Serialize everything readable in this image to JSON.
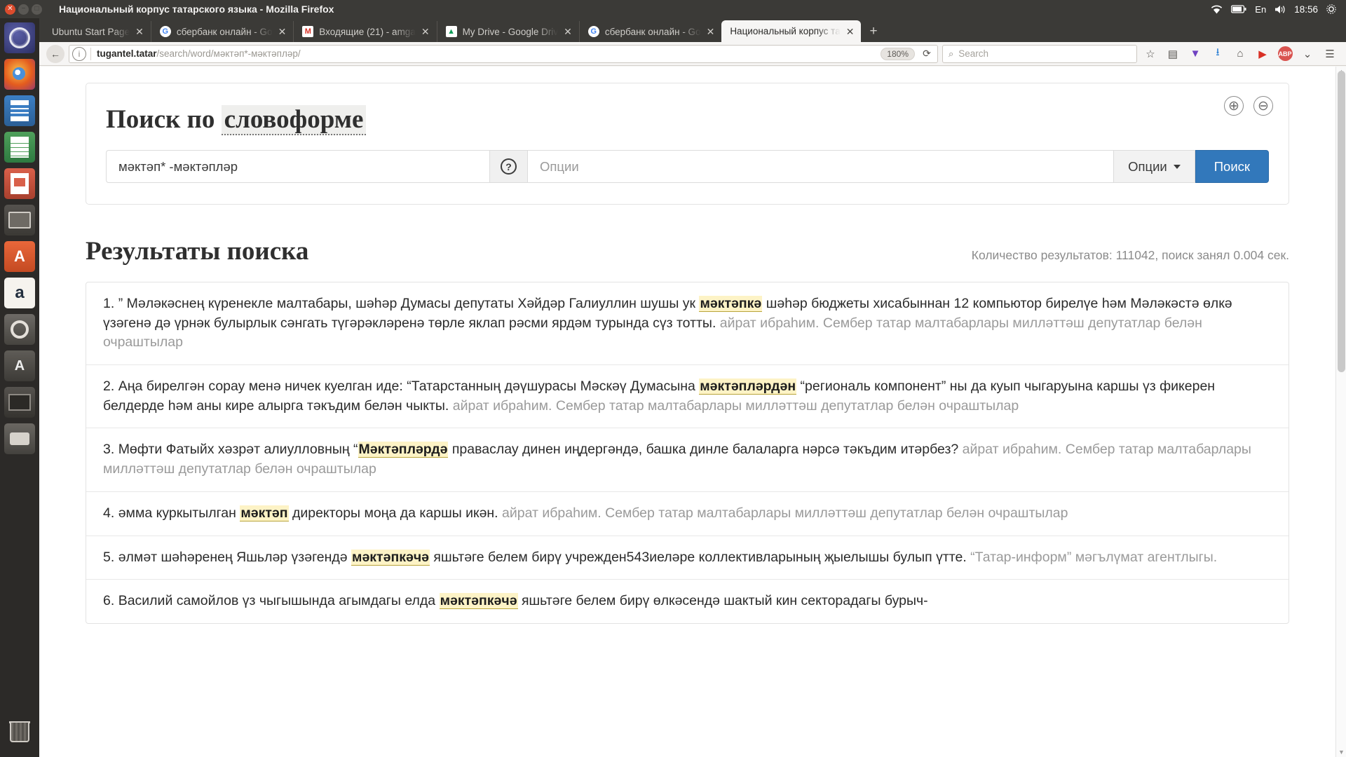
{
  "window": {
    "title": "Национальный корпус татарского языка - Mozilla Firefox",
    "close_glyph": "✕",
    "min_glyph": "−",
    "max_glyph": "□"
  },
  "tray": {
    "wifi_icon": "wifi-icon",
    "battery_icon": "battery-icon",
    "keyboard_layout": "En",
    "volume_icon": "volume-icon",
    "clock": "18:56",
    "gear_icon": "gear-icon"
  },
  "launcher": {
    "items": [
      {
        "name": "dash-home",
        "icon": "ubuntu-dash-icon"
      },
      {
        "name": "firefox",
        "icon": "firefox-icon"
      },
      {
        "name": "libreoffice-writer",
        "icon": "writer-icon"
      },
      {
        "name": "libreoffice-calc",
        "icon": "calc-icon"
      },
      {
        "name": "libreoffice-impress",
        "icon": "impress-icon"
      },
      {
        "name": "files",
        "icon": "files-icon"
      },
      {
        "name": "ubuntu-software",
        "icon": "software-icon"
      },
      {
        "name": "amazon",
        "icon": "amazon-icon"
      },
      {
        "name": "system-settings",
        "icon": "settings-icon"
      },
      {
        "name": "amazon-app",
        "icon": "amazon-app-icon"
      },
      {
        "name": "terminal",
        "icon": "terminal-icon"
      },
      {
        "name": "disk-usage",
        "icon": "disk-icon"
      },
      {
        "name": "trash",
        "icon": "trash-icon"
      }
    ]
  },
  "tabs": [
    {
      "label": "Ubuntu Start Page",
      "favicon": "none",
      "active": false
    },
    {
      "label": "сбербанк онлайн - Go",
      "favicon": "google",
      "active": false
    },
    {
      "label": "Входящие (21) - amga",
      "favicon": "gmail",
      "active": false
    },
    {
      "label": "My Drive - Google Driv",
      "favicon": "drive",
      "active": false
    },
    {
      "label": "сбербанк онлайн - Go",
      "favicon": "google",
      "active": false
    },
    {
      "label": "Национальный корпус та",
      "favicon": "none",
      "active": true
    }
  ],
  "tab_close_glyph": "✕",
  "new_tab_glyph": "+",
  "navbar": {
    "back_glyph": "←",
    "info_glyph": "ⓘ",
    "url_host": "tugantel.tatar",
    "url_path": "/search/word/мәктәп*-мәктәпләр/",
    "zoom_level": "180%",
    "reload_glyph": "⟳",
    "search_placeholder": "Search",
    "search_icon": "search-icon",
    "bookmark_icon": "star-icon",
    "reader_icon": "reader-view-icon",
    "pocket_icon": "pocket-icon",
    "downloads_icon": "download-icon",
    "home_icon": "home-icon",
    "youtube_icon": "youtube-icon",
    "account_badge": "ABP",
    "menu_icon": "hamburger-menu-icon"
  },
  "panel": {
    "zoom_in_glyph": "⊕",
    "zoom_out_glyph": "⊖",
    "title_prefix": "Поиск по",
    "title_highlight": "словоформе",
    "query_value": "мәктәп* -мәктәпләр",
    "help_glyph": "?",
    "options_placeholder": "Опции",
    "options_button": "Опции",
    "search_button": "Поиск"
  },
  "results": {
    "heading": "Результаты поиска",
    "count_line": "Количество результатов: 111042, поиск занял 0.004 сек.",
    "items": [
      {
        "index": "1.",
        "parts": [
          {
            "t": "” Мәләкәснең күренекле малтабары, шәһәр Думасы депутаты Хәйдәр Галиуллин шушы ук ",
            "k": "body"
          },
          {
            "t": "мәктәпкә",
            "k": "mark"
          },
          {
            "t": " шәһәр бюджеты хисабыннан 12 компьютор бирелүе һәм Мәләкәстә өлкә үзәгенә дә үрнәк булырлык сәнгать түгәрәкләренә төрле яклап рәсми ярдәм турында сүз тотты.",
            "k": "body"
          },
          {
            "t": " айрат ибраһим. Сембер татар малтабарлары милләттәш депутатлар белән очраштылар",
            "k": "meta"
          }
        ]
      },
      {
        "index": "2.",
        "parts": [
          {
            "t": "Аңа бирелгән сорау менә ничек куелган иде: “Татарстанның дәүшурасы Мәскәү Думасына ",
            "k": "body"
          },
          {
            "t": "мәктәпләрдән",
            "k": "mark"
          },
          {
            "t": " “региональ компонент” ны да куып чыгаруына каршы үз фикерен белдерде һәм аны кире алырга тәкъдим белән чыкты.",
            "k": "body"
          },
          {
            "t": " айрат ибраһим. Сембер татар малтабарлары милләттәш депутатлар белән очраштылар",
            "k": "meta"
          }
        ]
      },
      {
        "index": "3.",
        "parts": [
          {
            "t": "Мөфти Фатыйх хәзрәт алиулловның “",
            "k": "body"
          },
          {
            "t": "Мәктәпләрдә",
            "k": "mark"
          },
          {
            "t": " праваслау динен иңдергәндә, башка динле балаларга нәрсә тәкъдим итәрбез?",
            "k": "body"
          },
          {
            "t": " айрат ибраһим. Сембер татар малтабарлары милләттәш депутатлар белән очраштылар",
            "k": "meta"
          }
        ]
      },
      {
        "index": "4.",
        "parts": [
          {
            "t": "әмма куркытылган ",
            "k": "body"
          },
          {
            "t": "мәктәп",
            "k": "mark"
          },
          {
            "t": " директоры моңа да каршы икән.",
            "k": "body"
          },
          {
            "t": " айрат ибраһим. Сембер татар малтабарлары милләттәш депутатлар белән очраштылар",
            "k": "meta"
          }
        ]
      },
      {
        "index": "5.",
        "parts": [
          {
            "t": "әлмәт шәһәренең Яшьләр үзәгендә ",
            "k": "body"
          },
          {
            "t": "мәктәпкәчә",
            "k": "mark"
          },
          {
            "t": " яшьтәге белем бирү учрежден543иеләре коллективларының җыелышы булып үтте.",
            "k": "body"
          },
          {
            "t": " “Татар-информ” мәгълүмат агентлыгы.",
            "k": "meta"
          }
        ]
      },
      {
        "index": "6.",
        "parts": [
          {
            "t": "Василий самойлов үз чыгышында агымдагы елда ",
            "k": "body"
          },
          {
            "t": "мәктәпкәчә",
            "k": "mark"
          },
          {
            "t": " яшьтәге белем бирү өлкәсендә шактый кин секторадагы бурыч-",
            "k": "body"
          }
        ]
      }
    ]
  }
}
